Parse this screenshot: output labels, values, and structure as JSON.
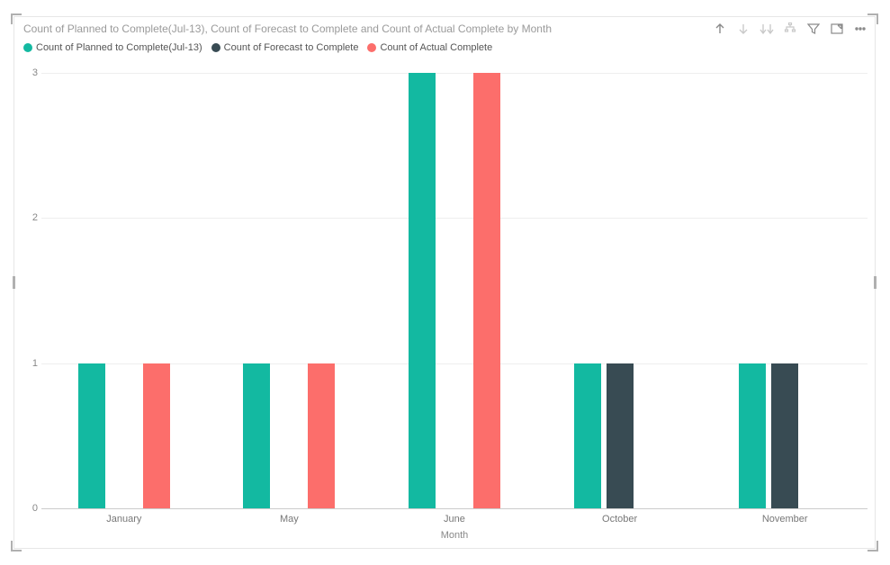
{
  "title": "Count of Planned to Complete(Jul-13), Count of Forecast to Complete and Count of Actual Complete by Month",
  "legend": [
    {
      "label": "Count of Planned to Complete(Jul-13)",
      "color": "#13b9a1"
    },
    {
      "label": "Count of Forecast to Complete",
      "color": "#384b53"
    },
    {
      "label": "Count of Actual Complete",
      "color": "#fc6e6b"
    }
  ],
  "toolbar": {
    "drill_up": "Drill up",
    "drill_down": "Drill down",
    "expand_all": "Expand all",
    "drill_mode": "Drill mode",
    "filter": "Filter",
    "focus": "Focus mode",
    "more": "More options"
  },
  "axis": {
    "x_title": "Month",
    "y_ticks": [
      "0",
      "1",
      "2",
      "3"
    ]
  },
  "chart_data": {
    "type": "bar",
    "title": "Count of Planned to Complete(Jul-13), Count of Forecast to Complete and Count of Actual Complete by Month",
    "xlabel": "Month",
    "ylabel": "",
    "ylim": [
      0,
      3
    ],
    "categories": [
      "January",
      "May",
      "June",
      "October",
      "November"
    ],
    "series": [
      {
        "name": "Count of Planned to Complete(Jul-13)",
        "color": "#13b9a1",
        "values": [
          1,
          1,
          3,
          1,
          1
        ]
      },
      {
        "name": "Count of Forecast to Complete",
        "color": "#384b53",
        "values": [
          0,
          0,
          0,
          1,
          1
        ]
      },
      {
        "name": "Count of Actual Complete",
        "color": "#fc6e6b",
        "values": [
          1,
          1,
          3,
          0,
          0
        ]
      }
    ]
  }
}
